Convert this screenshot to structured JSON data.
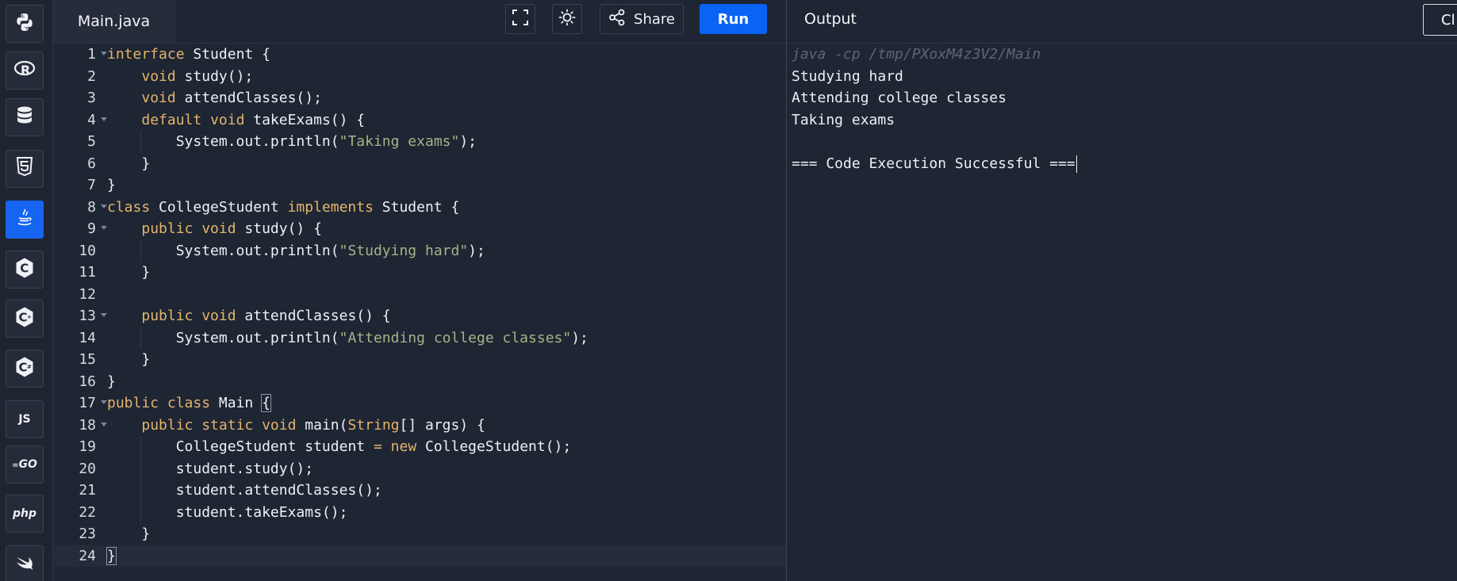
{
  "sidebar": {
    "languages": [
      {
        "name": "python",
        "icon": "python-icon"
      },
      {
        "name": "r",
        "icon": "r-icon",
        "label": "R"
      },
      {
        "name": "sql",
        "icon": "database-icon"
      },
      {
        "name": "html",
        "icon": "html5-icon",
        "label": "5"
      },
      {
        "name": "java",
        "icon": "java-icon",
        "active": true
      },
      {
        "name": "c",
        "icon": "c-icon",
        "label": "C"
      },
      {
        "name": "cpp",
        "icon": "cpp-icon",
        "label": "C"
      },
      {
        "name": "csharp",
        "icon": "csharp-icon",
        "label": "C"
      },
      {
        "name": "javascript",
        "icon": "js-icon",
        "label": "JS"
      },
      {
        "name": "go",
        "icon": "go-icon",
        "label": "GO"
      },
      {
        "name": "php",
        "icon": "php-icon",
        "label": "php"
      },
      {
        "name": "swift",
        "icon": "swift-icon"
      }
    ]
  },
  "editor": {
    "file_tab": "Main.java",
    "share_label": "Share",
    "run_label": "Run",
    "line_numbers": [
      "1",
      "2",
      "3",
      "4",
      "5",
      "6",
      "7",
      "8",
      "9",
      "10",
      "11",
      "12",
      "13",
      "14",
      "15",
      "16",
      "17",
      "18",
      "19",
      "20",
      "21",
      "22",
      "23",
      "24"
    ],
    "lines": {
      "l1a": "interface",
      "l1b": " Student {",
      "l2a": "void",
      "l2b": " study();",
      "l3a": "void",
      "l3b": " attendClasses();",
      "l4a": "default void",
      "l4b": " takeExams() {",
      "l5a": "System.out.println(",
      "l5b": "\"Taking exams\"",
      "l5c": ");",
      "l6": "}",
      "l7": "}",
      "l8a": "class",
      "l8b": " CollegeStudent ",
      "l8c": "implements",
      "l8d": " Student {",
      "l9a": "public void",
      "l9b": " study() {",
      "l10a": "System.out.println(",
      "l10b": "\"Studying hard\"",
      "l10c": ");",
      "l11": "}",
      "l13a": "public void",
      "l13b": " attendClasses() {",
      "l14a": "System.out.println(",
      "l14b": "\"Attending college classes\"",
      "l14c": ");",
      "l15": "}",
      "l16": "}",
      "l17a": "public class",
      "l17b": " Main ",
      "l17c": "{",
      "l18a": "public static void",
      "l18b": " main(",
      "l18c": "String",
      "l18d": "[] args) {",
      "l19a": "CollegeStudent student ",
      "l19b": "=",
      "l19c": " ",
      "l19d": "new",
      "l19e": " CollegeStudent();",
      "l20": "student.study();",
      "l21": "student.attendClasses();",
      "l22": "student.takeExams();",
      "l23": "}",
      "l24": "}"
    }
  },
  "output": {
    "title": "Output",
    "clear_label": "Cl",
    "command": "java -cp /tmp/PXoxM4z3V2/Main",
    "lines": [
      "Studying hard",
      "Attending college classes",
      "Taking exams",
      "",
      "=== Code Execution Successful ==="
    ]
  },
  "colors": {
    "accent": "#0b63f5",
    "keyword": "#e3b56b",
    "string": "#a6b386",
    "background": "#1e2533"
  }
}
